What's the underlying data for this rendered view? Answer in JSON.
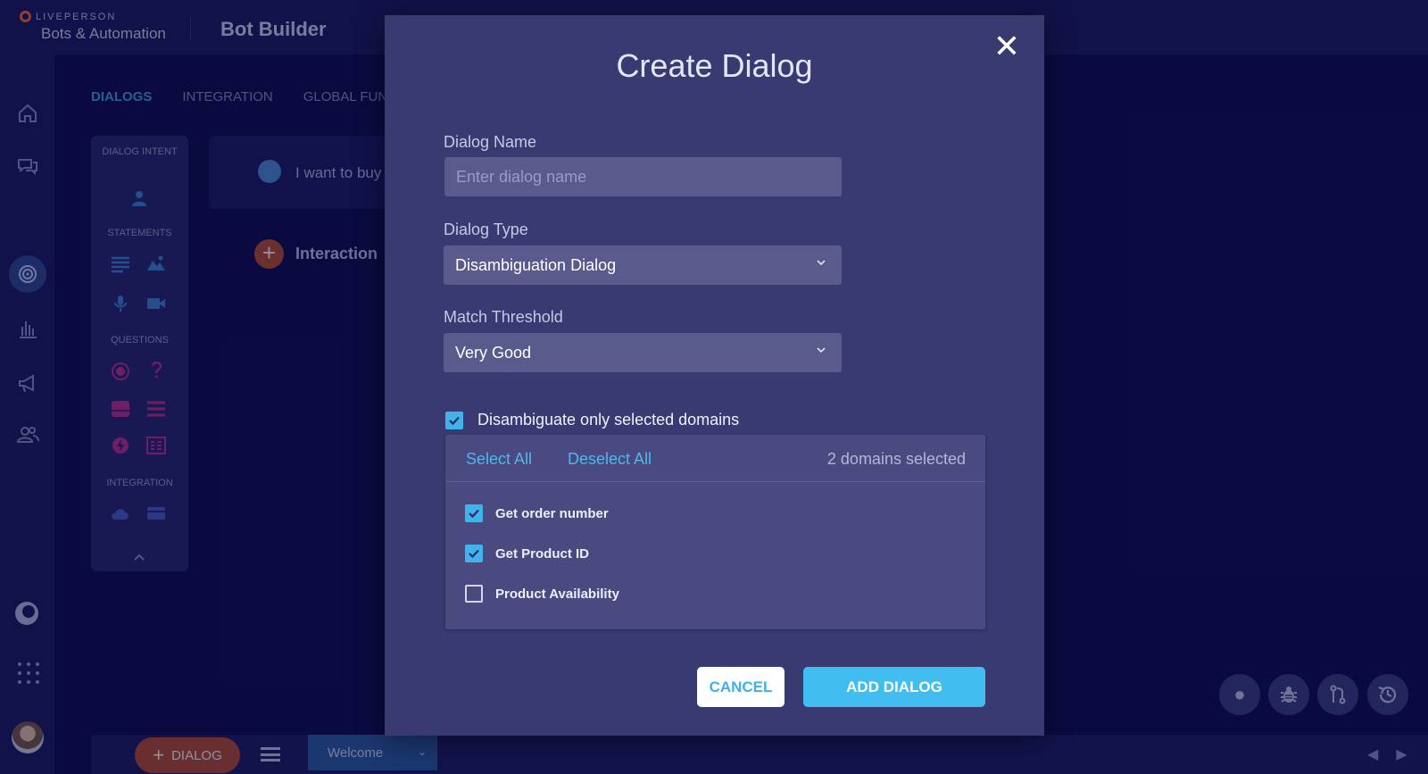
{
  "header": {
    "brand": "LIVEPERSON",
    "brand_sub": "Bots & Automation",
    "app_title": "Bot Builder"
  },
  "tabs": [
    {
      "label": "DIALOGS",
      "active": true
    },
    {
      "label": "INTEGRATION",
      "active": false
    },
    {
      "label": "GLOBAL FUN",
      "active": false
    }
  ],
  "palette": {
    "dialog_intent": "DIALOG INTENT",
    "statements": "STATEMENTS",
    "questions": "QUESTIONS",
    "integration": "INTEGRATION"
  },
  "canvas": {
    "user_text": "I want to buy",
    "interaction_label": "Interaction"
  },
  "bottom": {
    "add_dialog_label": "DIALOG",
    "current_dialog": "Welcome"
  },
  "modal": {
    "title": "Create Dialog",
    "close_glyph": "✕",
    "dialog_name_label": "Dialog Name",
    "dialog_name_value": "",
    "dialog_name_placeholder": "Enter dialog name",
    "dialog_type_label": "Dialog Type",
    "dialog_type_value": "Disambiguation Dialog",
    "match_threshold_label": "Match Threshold",
    "match_threshold_value": "Very Good",
    "disambiguate_label": "Disambiguate only selected domains",
    "disambiguate_checked": true,
    "select_all": "Select All",
    "deselect_all": "Deselect All",
    "selected_count": "2 domains selected",
    "domains": [
      {
        "name": "Get order number",
        "checked": true
      },
      {
        "name": "Get Product ID",
        "checked": true
      },
      {
        "name": "Product Availability",
        "checked": false
      }
    ],
    "cancel_label": "CANCEL",
    "add_label": "ADD DIALOG"
  },
  "colors": {
    "accent": "#42bdf0",
    "modal_bg": "#3a3a72",
    "page_bg": "#0d0c4a",
    "brand_orange": "#ff6a2c"
  }
}
